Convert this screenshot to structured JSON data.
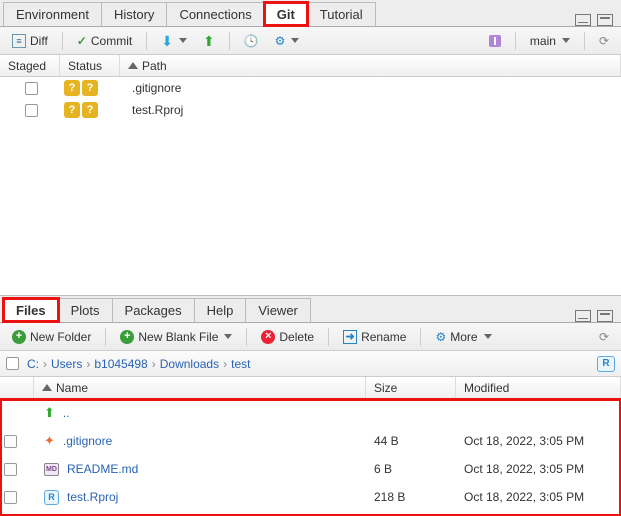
{
  "top_tabs": [
    "Environment",
    "History",
    "Connections",
    "Git",
    "Tutorial"
  ],
  "active_top_tab": 3,
  "highlight_top_tab": 3,
  "git_toolbar": {
    "diff": "Diff",
    "commit": "Commit",
    "branch": "main"
  },
  "git_columns": [
    "Staged",
    "Status",
    "Path"
  ],
  "git_rows": [
    {
      "path": ".gitignore"
    },
    {
      "path": "test.Rproj"
    }
  ],
  "bottom_tabs": [
    "Files",
    "Plots",
    "Packages",
    "Help",
    "Viewer"
  ],
  "active_bottom_tab": 0,
  "highlight_bottom_tab": 0,
  "files_toolbar": {
    "new_folder": "New Folder",
    "new_blank": "New Blank File",
    "delete": "Delete",
    "rename": "Rename",
    "more": "More"
  },
  "breadcrumbs": [
    "C:",
    "Users",
    "b1045498",
    "Downloads",
    "test"
  ],
  "files_columns": {
    "name": "Name",
    "size": "Size",
    "modified": "Modified"
  },
  "updir": "..",
  "files": [
    {
      "icon": "gitignore",
      "name": ".gitignore",
      "size": "44 B",
      "modified": "Oct 18, 2022, 3:05 PM"
    },
    {
      "icon": "md",
      "name": "README.md",
      "size": "6 B",
      "modified": "Oct 18, 2022, 3:05 PM"
    },
    {
      "icon": "rproj",
      "name": "test.Rproj",
      "size": "218 B",
      "modified": "Oct 18, 2022, 3:05 PM"
    }
  ]
}
